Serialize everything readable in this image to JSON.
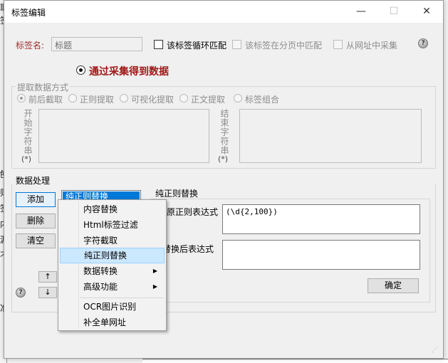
{
  "background": {
    "left_chars": [
      "耶",
      "签",
      "刨",
      "则",
      "签",
      "内",
      "漏",
      "不",
      "准"
    ]
  },
  "dialog": {
    "title": "标签编辑",
    "minimize_glyph": "—",
    "maximize_glyph": "☐",
    "close_glyph": "✕"
  },
  "tag": {
    "name_label": "标签名:",
    "name_value": "标题",
    "loop_match_label": "该标签循环匹配",
    "paging_match_label": "该标签在分页中匹配",
    "from_url_label": "从网址中采集"
  },
  "collect": {
    "radio_label": "通过采集得到数据"
  },
  "extract": {
    "group_label": "提取数据方式",
    "options": [
      "前后截取",
      "正则提取",
      "可视化提取",
      "正文提取",
      "标签组合"
    ],
    "start_label": "开始字符串",
    "start_star": "(*)",
    "end_label": "结束字符串",
    "end_star": "(*)"
  },
  "processing": {
    "section_label": "数据处理",
    "add_button": "添加",
    "delete_button": "删除",
    "clear_button": "清空",
    "up_glyph": "↑",
    "down_glyph": "↓",
    "list_items": [
      "纯正则替换"
    ],
    "regex_group_label": "纯正则替换",
    "source_regex_label": "原正则表达式",
    "source_regex_value": "(\\d{2,100})",
    "replace_label": "替换后表达式",
    "replace_value": "",
    "confirm_button": "确定"
  },
  "context_menu": {
    "items": [
      {
        "label": "内容替换"
      },
      {
        "label": "Html标签过滤"
      },
      {
        "label": "字符截取"
      },
      {
        "label": "纯正则替换"
      },
      {
        "label": "数据转换"
      },
      {
        "label": "高级功能"
      },
      {
        "label": "OCR图片识别"
      },
      {
        "label": "补全单网址"
      }
    ],
    "submenu_glyph": "▶"
  }
}
